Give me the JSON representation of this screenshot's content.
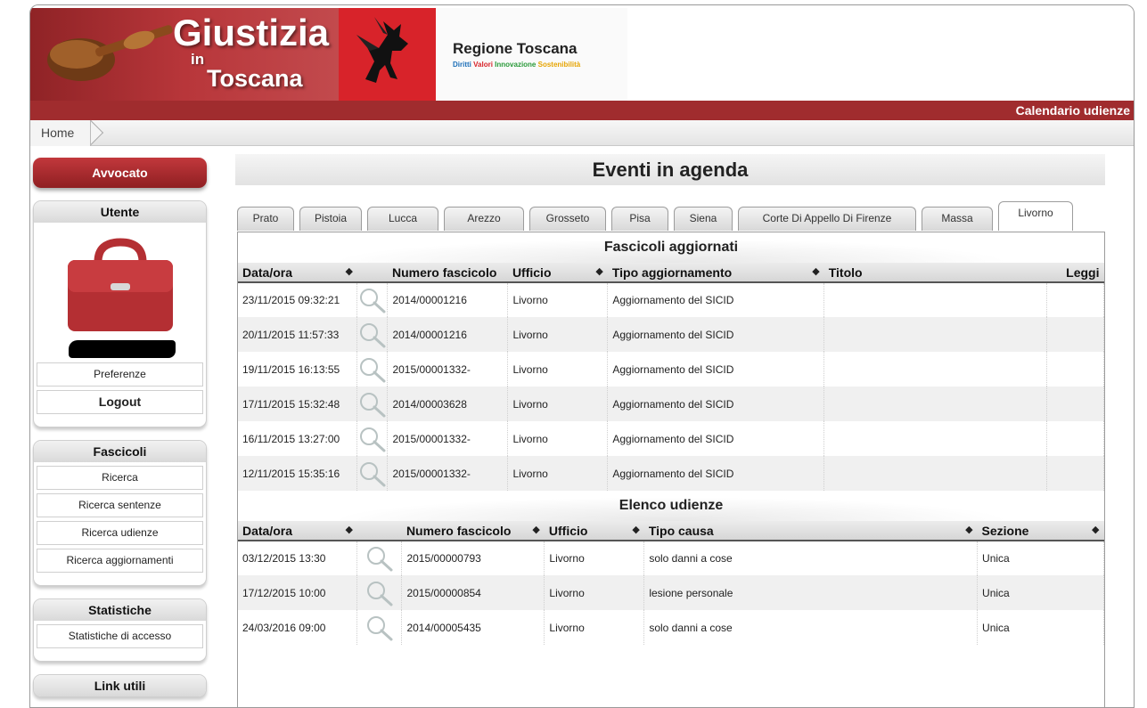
{
  "header": {
    "logo_title": "Giustizia",
    "logo_in": "in",
    "logo_sub": "Toscana",
    "regione_name": "Regione Toscana",
    "regione_motto": [
      "Diritti",
      "Valori",
      "Innovazione",
      "Sostenibilità"
    ],
    "calendar_link": "Calendario udienze",
    "breadcrumb_home": "Home"
  },
  "colors": {
    "brand_red": "#a02c2e",
    "button_red": "#c2383c",
    "regione_red": "#d8232a"
  },
  "sidebar": {
    "role_button": "Avvocato",
    "utente": {
      "title": "Utente",
      "icon": "briefcase-icon",
      "links": [
        "Preferenze",
        "Logout"
      ]
    },
    "fascicoli": {
      "title": "Fascicoli",
      "links": [
        "Ricerca",
        "Ricerca sentenze",
        "Ricerca udienze",
        "Ricerca aggiornamenti"
      ]
    },
    "statistiche": {
      "title": "Statistiche",
      "links": [
        "Statistiche di accesso"
      ]
    },
    "link_utili": {
      "title": "Link utili"
    }
  },
  "main": {
    "title": "Eventi in agenda",
    "tabs": [
      "Prato",
      "Pistoia",
      "Lucca",
      "Arezzo",
      "Grosseto",
      "Pisa",
      "Siena",
      "Corte Di Appello Di Firenze",
      "Massa",
      "Livorno"
    ],
    "active_tab": "Livorno",
    "fascicoli": {
      "title": "Fascicoli aggiornati",
      "headers": [
        "Data/ora",
        "Numero fascicolo",
        "Ufficio",
        "Tipo aggiornamento",
        "Titolo",
        "Leggi"
      ],
      "rows": [
        [
          "23/11/2015 09:32:21",
          "2014/00001216",
          "Livorno",
          "Aggiornamento del SICID",
          ""
        ],
        [
          "20/11/2015 11:57:33",
          "2014/00001216",
          "Livorno",
          "Aggiornamento del SICID",
          ""
        ],
        [
          "19/11/2015 16:13:55",
          "2015/00001332-",
          "Livorno",
          "Aggiornamento del SICID",
          ""
        ],
        [
          "17/11/2015 15:32:48",
          "2014/00003628",
          "Livorno",
          "Aggiornamento del SICID",
          ""
        ],
        [
          "16/11/2015 13:27:00",
          "2015/00001332-",
          "Livorno",
          "Aggiornamento del SICID",
          ""
        ],
        [
          "12/11/2015 15:35:16",
          "2015/00001332-",
          "Livorno",
          "Aggiornamento del SICID",
          ""
        ]
      ]
    },
    "udienze": {
      "title": "Elenco udienze",
      "headers": [
        "Data/ora",
        "Numero fascicolo",
        "Ufficio",
        "Tipo causa",
        "Sezione"
      ],
      "rows": [
        [
          "03/12/2015 13:30",
          "2015/00000793",
          "Livorno",
          "solo danni a cose",
          "Unica"
        ],
        [
          "17/12/2015 10:00",
          "2015/00000854",
          "Livorno",
          "lesione personale",
          "Unica"
        ],
        [
          "24/03/2016 09:00",
          "2014/00005435",
          "Livorno",
          "solo danni a cose",
          "Unica"
        ]
      ]
    }
  }
}
